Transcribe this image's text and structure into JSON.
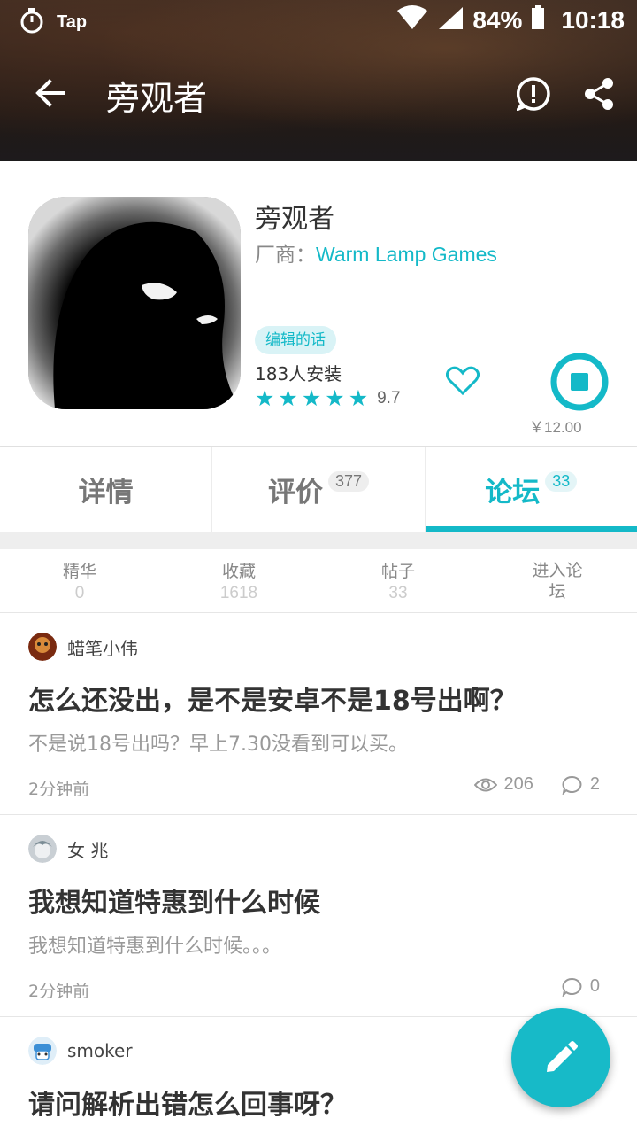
{
  "status_bar": {
    "app": "Tap",
    "battery": "84%",
    "time": "10:18"
  },
  "nav": {
    "title": "旁观者"
  },
  "app": {
    "name": "旁观者",
    "vendor_label": "厂商：",
    "vendor": "Warm Lamp Games",
    "editor_badge": "编辑的话",
    "installs": "183人安装",
    "rating_stars": 5,
    "rating": "9.7",
    "price": "￥12.00"
  },
  "tabs": [
    {
      "label": "详情",
      "count": ""
    },
    {
      "label": "评价",
      "count": "377"
    },
    {
      "label": "论坛",
      "count": "33"
    }
  ],
  "active_tab": 2,
  "forum_stats": [
    {
      "label": "精华",
      "value": "0"
    },
    {
      "label": "收藏",
      "value": "1618"
    },
    {
      "label": "帖子",
      "value": "33"
    },
    {
      "label": "进入论坛",
      "value": ""
    }
  ],
  "posts": [
    {
      "author": "蜡笔小伟",
      "title": "怎么还没出，是不是安卓不是18号出啊？",
      "excerpt": "不是说18号出吗？早上7.30没看到可以买。",
      "time": "2分钟前",
      "views": "206",
      "comments": "2"
    },
    {
      "author": "女 兆",
      "title": "我想知道特惠到什么时候",
      "excerpt": "我想知道特惠到什么时候。。。",
      "time": "2分钟前",
      "views": "",
      "comments": "0"
    },
    {
      "author": "smoker",
      "title": "请问解析出错怎么回事呀？",
      "excerpt": "",
      "time": "",
      "views": "",
      "comments": ""
    }
  ],
  "colors": {
    "accent": "#14b9c8",
    "header_dark": "#2a1e19"
  },
  "icons": [
    "stopwatch-icon",
    "wifi-icon",
    "signal-icon",
    "battery-icon",
    "back-arrow-icon",
    "report-icon",
    "share-icon",
    "heart-icon",
    "stop-download-icon",
    "star-icon",
    "eye-icon",
    "comment-icon",
    "edit-pencil-icon"
  ]
}
